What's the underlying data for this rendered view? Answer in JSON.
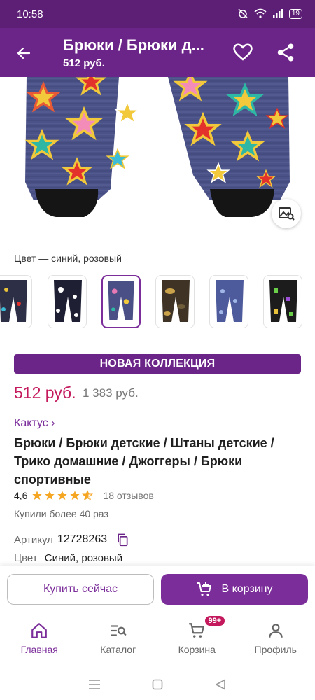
{
  "status_bar": {
    "time": "10:58",
    "battery": "19"
  },
  "appbar": {
    "title": "Брюки / Брюки д...",
    "subtitle": "512 руб."
  },
  "colors": {
    "brand": "#6b2487",
    "accent": "#7b2d9a",
    "price": "#c4195d"
  },
  "product": {
    "color_label": "Цвет — синий, розовый",
    "badge": "НОВАЯ КОЛЛЕКЦИЯ",
    "price": "512 руб.",
    "old_price": "1 383 руб.",
    "brand": "Кактус ›",
    "name": "Брюки / Брюки детские / Штаны детские / Трико домашние / Джоггеры / Брюки спортивные",
    "rating": "4,6",
    "rating_value": 4.6,
    "reviews": "18 отзывов",
    "bought": "Купили более 40 раз",
    "article_label": "Артикул",
    "article_value": "12728263",
    "color_field_label": "Цвет",
    "color_field_value": "Синий, розовый"
  },
  "variants": [
    {
      "name": "dark-multicolor",
      "bg": "#2c2f45",
      "pattern": "#e8c23a"
    },
    {
      "name": "black-stars",
      "bg": "#1e1f33",
      "pattern": "#ffffff"
    },
    {
      "name": "blue-pink-stars",
      "bg": "#4a4f86",
      "pattern": "#e779b4"
    },
    {
      "name": "camouflage",
      "bg": "#3e3325",
      "pattern": "#c9a24a"
    },
    {
      "name": "blue-hearts",
      "bg": "#4d5a9c",
      "pattern": "#9fb6e6"
    },
    {
      "name": "black-geometry",
      "bg": "#1c1c1c",
      "pattern": "#6ad04a"
    }
  ],
  "actions": {
    "buy_now": "Купить сейчас",
    "to_cart": "В корзину"
  },
  "nav": {
    "home": "Главная",
    "catalog": "Каталог",
    "cart": "Корзина",
    "cart_badge": "99+",
    "profile": "Профиль"
  }
}
